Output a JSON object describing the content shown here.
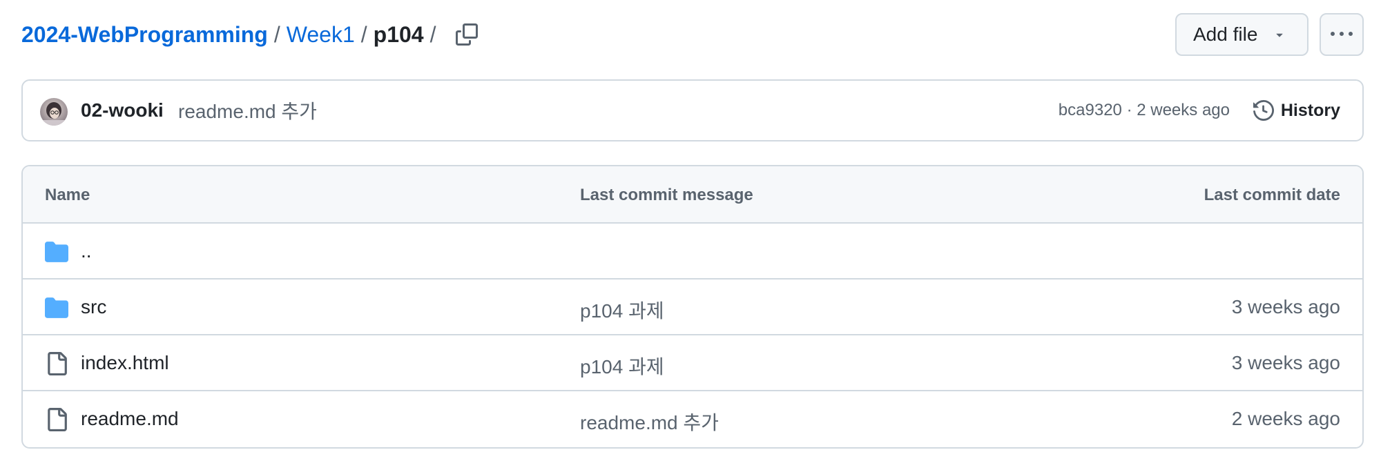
{
  "breadcrumb": {
    "repo": "2024-WebProgramming",
    "folder": "Week1",
    "current": "p104",
    "sep": "/"
  },
  "actions": {
    "add_file_label": "Add file"
  },
  "latest_commit": {
    "author": "02-wooki",
    "message": "readme.md 추가",
    "sha": "bca9320",
    "dot": "·",
    "time": "2 weeks ago",
    "history_label": "History"
  },
  "table": {
    "headers": {
      "name": "Name",
      "message": "Last commit message",
      "date": "Last commit date"
    },
    "rows": [
      {
        "name": "..",
        "type": "folder",
        "message": "",
        "date": ""
      },
      {
        "name": "src",
        "type": "folder",
        "message": "p104 과제",
        "date": "3 weeks ago"
      },
      {
        "name": "index.html",
        "type": "file",
        "message": "p104 과제",
        "date": "3 weeks ago"
      },
      {
        "name": "readme.md",
        "type": "file",
        "message": "readme.md 추가",
        "date": "2 weeks ago"
      }
    ]
  },
  "colors": {
    "link": "#0969da",
    "folder": "#54aeff",
    "muted": "#59636e",
    "border": "#d1d9e0"
  }
}
